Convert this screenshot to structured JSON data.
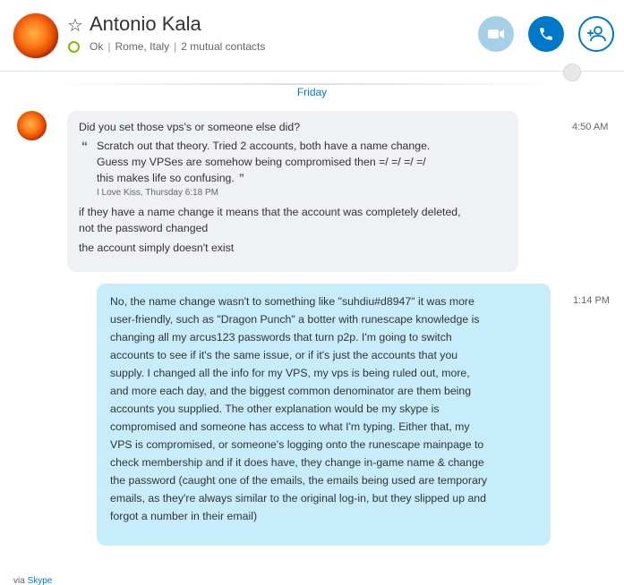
{
  "contact": {
    "name": "Antonio Kala",
    "status": "Ok",
    "location": "Rome, Italy",
    "mutual": "2 mutual contacts"
  },
  "colors": {
    "accent": "#0078c8",
    "online": "#7fba00",
    "outgoing_bubble": "#c7edfc",
    "incoming_bubble": "#f0f1f4"
  },
  "conversation": {
    "date_divider": "Friday",
    "incoming": {
      "time": "4:50 AM",
      "first": "Did you set those vps's or someone else did?",
      "quote_lines": [
        "Scratch out that theory.  Tried 2 accounts, both have a name change.",
        "Guess my VPSes are somehow being compromised then =/ =/ =/ =/",
        "this makes life so confusing."
      ],
      "quote_meta": "I Love Kiss, Thursday 6:18 PM",
      "lines_after": [
        "if they have a name change it means that the account was completely deleted,",
        "not the password changed"
      ],
      "last": "the account simply doesn't exist"
    },
    "outgoing": {
      "time": "1:14 PM",
      "lines": [
        "No, the name change wasn't to something like \"suhdiu#d8947\" it was more",
        "user-friendly, such as \"Dragon Punch\"  a botter with runescape knowledge is",
        "changing all my arcus123 passwords that turn p2p. I'm going to switch",
        "accounts to see if it's the same issue, or if it's just the accounts that you",
        "supply.  I changed all the info for my VPS, my vps is being ruled out, more,",
        "and more each day, and the biggest common denominator are them being",
        "accounts you supplied.  The other explanation would be my skype is",
        "compromised and someone has access to what I'm typing.  Either that, my",
        "VPS is compromised, or someone's  logging onto the runescape mainpage to",
        "check membership and if it does have, they change in-game name & change",
        "the password (caught one of the emails, the emails being used are temporary",
        "emails, as they're always similar to the original log-in, but they slipped up and",
        "forgot a number in their email)"
      ]
    }
  },
  "footer": {
    "via": "via",
    "via_link": "Skype"
  },
  "icons": [
    "star-icon",
    "video-call-icon",
    "phone-icon",
    "add-person-icon",
    "sync-icon"
  ]
}
